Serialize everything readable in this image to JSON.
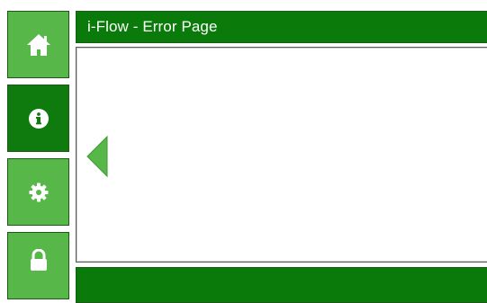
{
  "header": {
    "title": "i-Flow - Error Page"
  },
  "sidebar": {
    "items": [
      {
        "name": "home",
        "icon": "home-icon",
        "active": false
      },
      {
        "name": "info",
        "icon": "info-icon",
        "active": true
      },
      {
        "name": "settings",
        "icon": "gear-icon",
        "active": false
      },
      {
        "name": "lock",
        "icon": "lock-icon",
        "active": false
      }
    ]
  },
  "colors": {
    "accent_dark": "#0a7a0b",
    "accent_light": "#57b748",
    "active_button": "#0f7a0e",
    "icon": "#ffffff"
  }
}
